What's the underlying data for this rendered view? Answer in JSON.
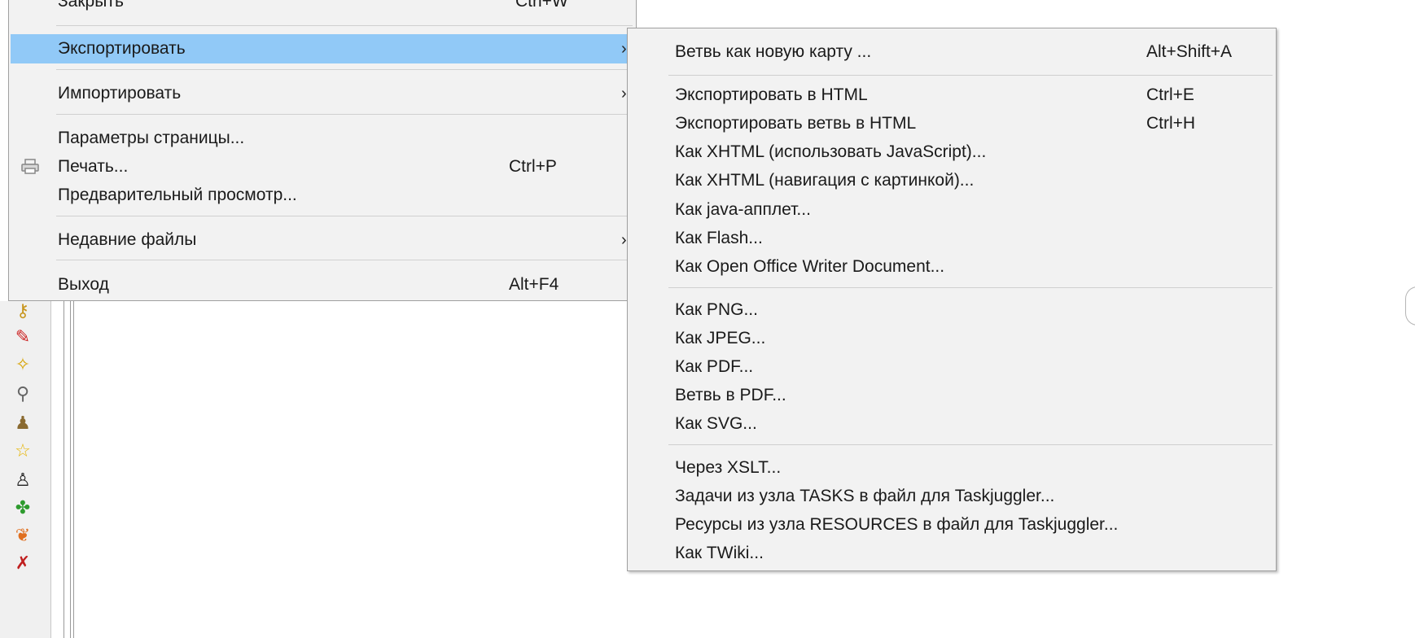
{
  "main_menu": {
    "items": [
      {
        "label": "Закрыть",
        "accel": "Ctrl+W"
      },
      {
        "label": "Экспортировать",
        "submenu": true,
        "highlighted": true
      },
      {
        "label": "Импортировать",
        "submenu": true
      },
      {
        "label": "Параметры страницы..."
      },
      {
        "label": "Печать...",
        "accel": "Ctrl+P",
        "icon": "printer-icon"
      },
      {
        "label": "Предварительный просмотр..."
      },
      {
        "label": "Недавние файлы",
        "submenu": true
      },
      {
        "label": "Выход",
        "accel": "Alt+F4"
      }
    ],
    "arrow_glyph": "›",
    "highlight_color": "#91c9f7"
  },
  "export_submenu": {
    "items": [
      {
        "label": "Ветвь как новую карту ...",
        "accel": "Alt+Shift+A"
      },
      {
        "label": "Экспортировать в HTML",
        "accel": "Ctrl+E"
      },
      {
        "label": "Экспортировать ветвь в HTML",
        "accel": "Ctrl+H"
      },
      {
        "label": "Как XHTML (использовать JavaScript)..."
      },
      {
        "label": "Как XHTML (навигация с картинкой)..."
      },
      {
        "label": "Как java-апплет..."
      },
      {
        "label": "Как Flash..."
      },
      {
        "label": "Как Open Office Writer Document..."
      },
      {
        "label": "Как PNG..."
      },
      {
        "label": "Как JPEG..."
      },
      {
        "label": "Как PDF..."
      },
      {
        "label": "Ветвь в PDF..."
      },
      {
        "label": "Как SVG..."
      },
      {
        "label": "Через XSLT..."
      },
      {
        "label": "Задачи из узла TASKS в файл для Taskjuggler..."
      },
      {
        "label": "Ресурсы из узла RESOURCES в файл для Taskjuggler..."
      },
      {
        "label": "Как TWiki..."
      }
    ]
  },
  "toolbar_icons": [
    "key-icon",
    "pencil-icon",
    "magic-wand-icon",
    "magnifier-icon",
    "bell-icon",
    "star-icon",
    "penguin-icon",
    "clover-icon",
    "butterfly-icon",
    "runner-icon"
  ]
}
